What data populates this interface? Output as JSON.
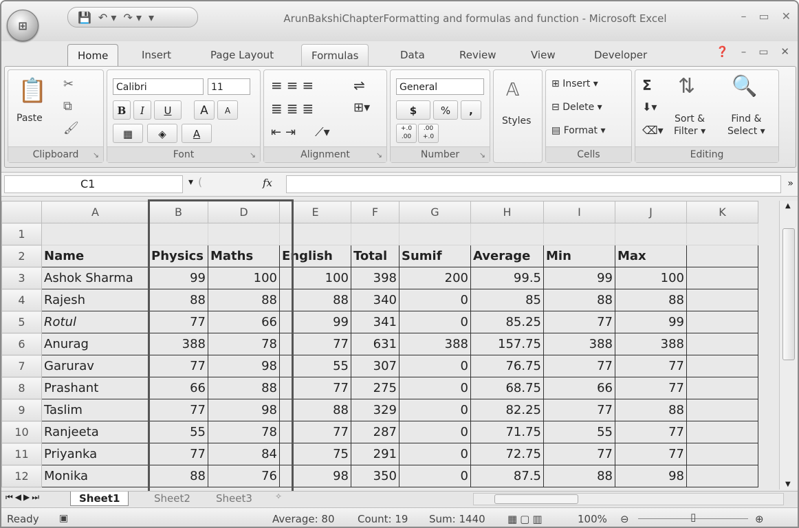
{
  "window": {
    "title": "ArunBakshiChapterFormatting and formulas and function - Microsoft Excel",
    "office_button": "Office",
    "qat_icons": [
      "save-icon",
      "undo-icon",
      "redo-icon",
      "customize-icon"
    ]
  },
  "tabs": [
    "Home",
    "Insert",
    "Page Layout",
    "Formulas",
    "Data",
    "Review",
    "View",
    "Developer"
  ],
  "ribbon": {
    "clipboard": {
      "label": "Clipboard",
      "paste": "Paste"
    },
    "font": {
      "label": "Font",
      "name": "Calibri",
      "size": "11",
      "bold": "B",
      "italic": "I",
      "underline": "U",
      "grow": "A",
      "shrink": "A",
      "color": "A"
    },
    "alignment": {
      "label": "Alignment"
    },
    "number": {
      "label": "Number",
      "format": "General",
      "currency": "$",
      "percent": "%",
      "comma": ",",
      "inc_dec": "+.0 .00",
      "dec_dec": ".00 +.0"
    },
    "styles": {
      "label": "Styles"
    },
    "cells": {
      "label": "Cells",
      "insert": "Insert",
      "delete": "Delete",
      "format": "Format"
    },
    "editing": {
      "label": "Editing",
      "sigma": "Σ",
      "sort": "Sort &",
      "sort2": "Filter",
      "find": "Find &",
      "find2": "Select"
    }
  },
  "formula_bar": {
    "name_box": "C1",
    "fx": "fx",
    "value": ""
  },
  "columns": [
    "A",
    "B",
    "D",
    "E",
    "F",
    "G",
    "H",
    "I",
    "J",
    "K"
  ],
  "rows": [
    {
      "n": "1",
      "cells": [
        "",
        "",
        "",
        "",
        "",
        "",
        "",
        "",
        "",
        ""
      ]
    },
    {
      "n": "2",
      "cells": [
        "Name",
        "Physics",
        "Maths",
        "English",
        "Total",
        "Sumif",
        "Average",
        "Min",
        "Max",
        ""
      ]
    },
    {
      "n": "3",
      "cells": [
        "Ashok Sharma",
        "99",
        "100",
        "100",
        "398",
        "200",
        "99.5",
        "99",
        "100",
        ""
      ]
    },
    {
      "n": "4",
      "cells": [
        "Rajesh",
        "88",
        "88",
        "88",
        "340",
        "0",
        "85",
        "88",
        "88",
        ""
      ]
    },
    {
      "n": "5",
      "cells": [
        "Rotul",
        "77",
        "66",
        "99",
        "341",
        "0",
        "85.25",
        "77",
        "99",
        ""
      ]
    },
    {
      "n": "6",
      "cells": [
        "Anurag",
        "388",
        "78",
        "77",
        "631",
        "388",
        "157.75",
        "388",
        "388",
        ""
      ]
    },
    {
      "n": "7",
      "cells": [
        "Garurav",
        "77",
        "98",
        "55",
        "307",
        "0",
        "76.75",
        "77",
        "77",
        ""
      ]
    },
    {
      "n": "8",
      "cells": [
        "Prashant",
        "66",
        "88",
        "77",
        "275",
        "0",
        "68.75",
        "66",
        "77",
        ""
      ]
    },
    {
      "n": "9",
      "cells": [
        "Taslim",
        "77",
        "98",
        "88",
        "329",
        "0",
        "82.25",
        "77",
        "88",
        ""
      ]
    },
    {
      "n": "10",
      "cells": [
        "Ranjeeta",
        "55",
        "78",
        "77",
        "287",
        "0",
        "71.75",
        "55",
        "77",
        ""
      ]
    },
    {
      "n": "11",
      "cells": [
        "Priyanka",
        "77",
        "84",
        "75",
        "291",
        "0",
        "72.75",
        "77",
        "77",
        ""
      ]
    },
    {
      "n": "12",
      "cells": [
        "Monika",
        "88",
        "76",
        "98",
        "350",
        "0",
        "87.5",
        "88",
        "98",
        ""
      ]
    }
  ],
  "sheet_tabs": [
    "Sheet1",
    "Sheet2",
    "Sheet3"
  ],
  "status": {
    "ready": "Ready",
    "average": "Average: 80",
    "count": "Count: 19",
    "sum": "Sum: 1440",
    "zoom": "100%"
  }
}
